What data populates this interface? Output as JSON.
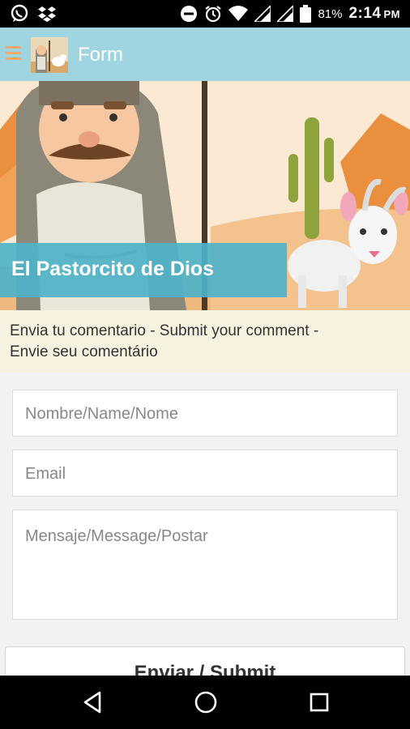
{
  "status_bar": {
    "battery_percent": "81%",
    "time": "2:14",
    "time_suffix": "PM",
    "icons": [
      "whatsapp-icon",
      "dropbox-icon",
      "do-not-disturb-icon",
      "alarm-icon",
      "wifi-icon",
      "signal-icon",
      "signal-icon",
      "battery-icon"
    ]
  },
  "app_bar": {
    "title": "Form",
    "menu_icon": "hamburger-menu-icon",
    "logo_icon": "shepherd-logo-icon",
    "background": "#9fd4e0"
  },
  "hero": {
    "banner_title": "El Pastorcito de Dios",
    "banner_color": "#4eb2c8"
  },
  "intro": {
    "text_line1": "Envia tu comentario - Submit your comment -",
    "text_line2": "Envie seu comentário"
  },
  "form": {
    "name_placeholder": "Nombre/Name/Nome",
    "email_placeholder": "Email",
    "message_placeholder": "Mensaje/Message/Postar",
    "submit_label": "Enviar / Submit"
  },
  "nav_bar": {
    "icons": [
      "back-icon",
      "home-icon",
      "recents-icon"
    ]
  }
}
